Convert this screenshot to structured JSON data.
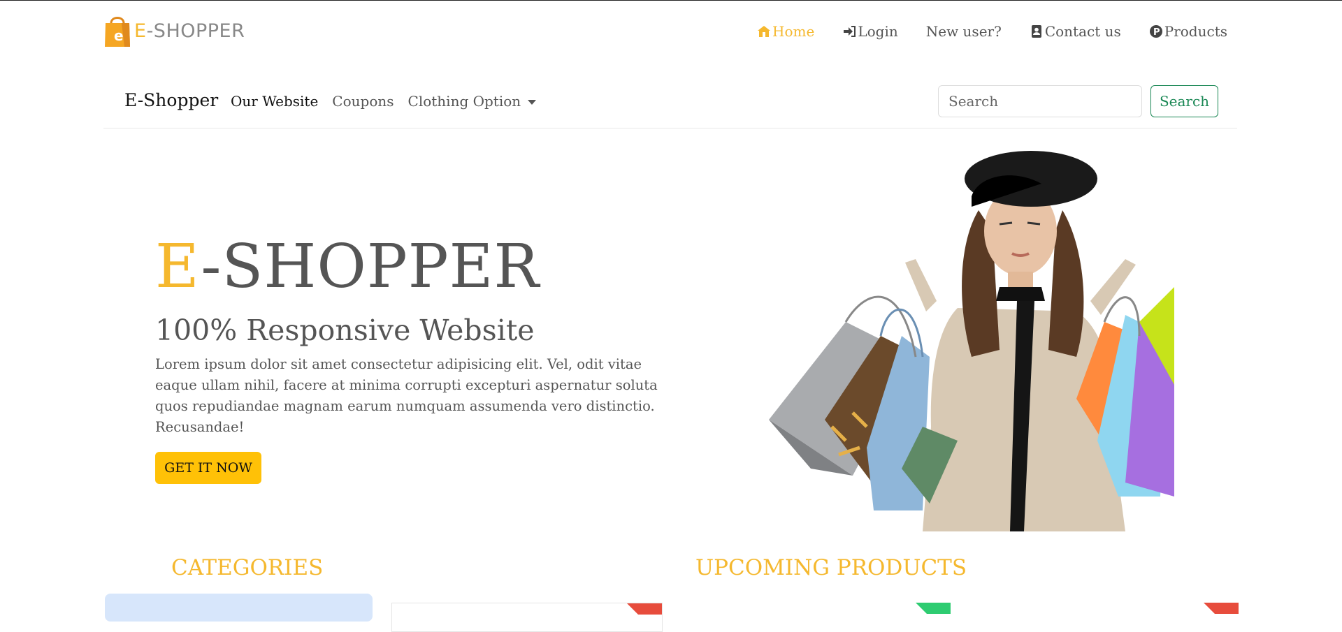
{
  "logo": {
    "letter": "E",
    "rest": "-SHOPPER",
    "bag_letter": "e"
  },
  "topnav": [
    {
      "label": "Home",
      "icon": "home-icon",
      "active": true
    },
    {
      "label": "Login",
      "icon": "sign-in-icon",
      "active": false
    },
    {
      "label": "New user?",
      "icon": "",
      "active": false
    },
    {
      "label": "Contact us",
      "icon": "contact-card-icon",
      "active": false
    },
    {
      "label": "Products",
      "icon": "p-circle-icon",
      "active": false
    }
  ],
  "navbar": {
    "brand": "E-Shopper",
    "links": [
      "Our Website",
      "Coupons",
      "Clothing Option"
    ],
    "search_placeholder": "Search",
    "search_button": "Search"
  },
  "hero": {
    "title_first": "E",
    "title_rest": "-SHOPPER",
    "subtitle": "100% Responsive Website",
    "text": "Lorem ipsum dolor sit amet consectetur adipisicing elit. Vel, odit vitae eaque ullam nihil, facere at minima corrupti excepturi aspernatur soluta quos repudiandae magnam earum numquam assumenda vero distinctio. Recusandae!",
    "button": "GET IT NOW"
  },
  "sections": {
    "categories": "CATEGORIES",
    "upcoming": "UPCOMING PRODUCTS"
  },
  "colors": {
    "accent": "#f5b82e",
    "success": "#198754",
    "button": "#ffc107",
    "text": "#555555",
    "ribbon_red": "#e74c3c",
    "ribbon_green": "#2ecc71",
    "category_bg": "#d7e6fb"
  }
}
